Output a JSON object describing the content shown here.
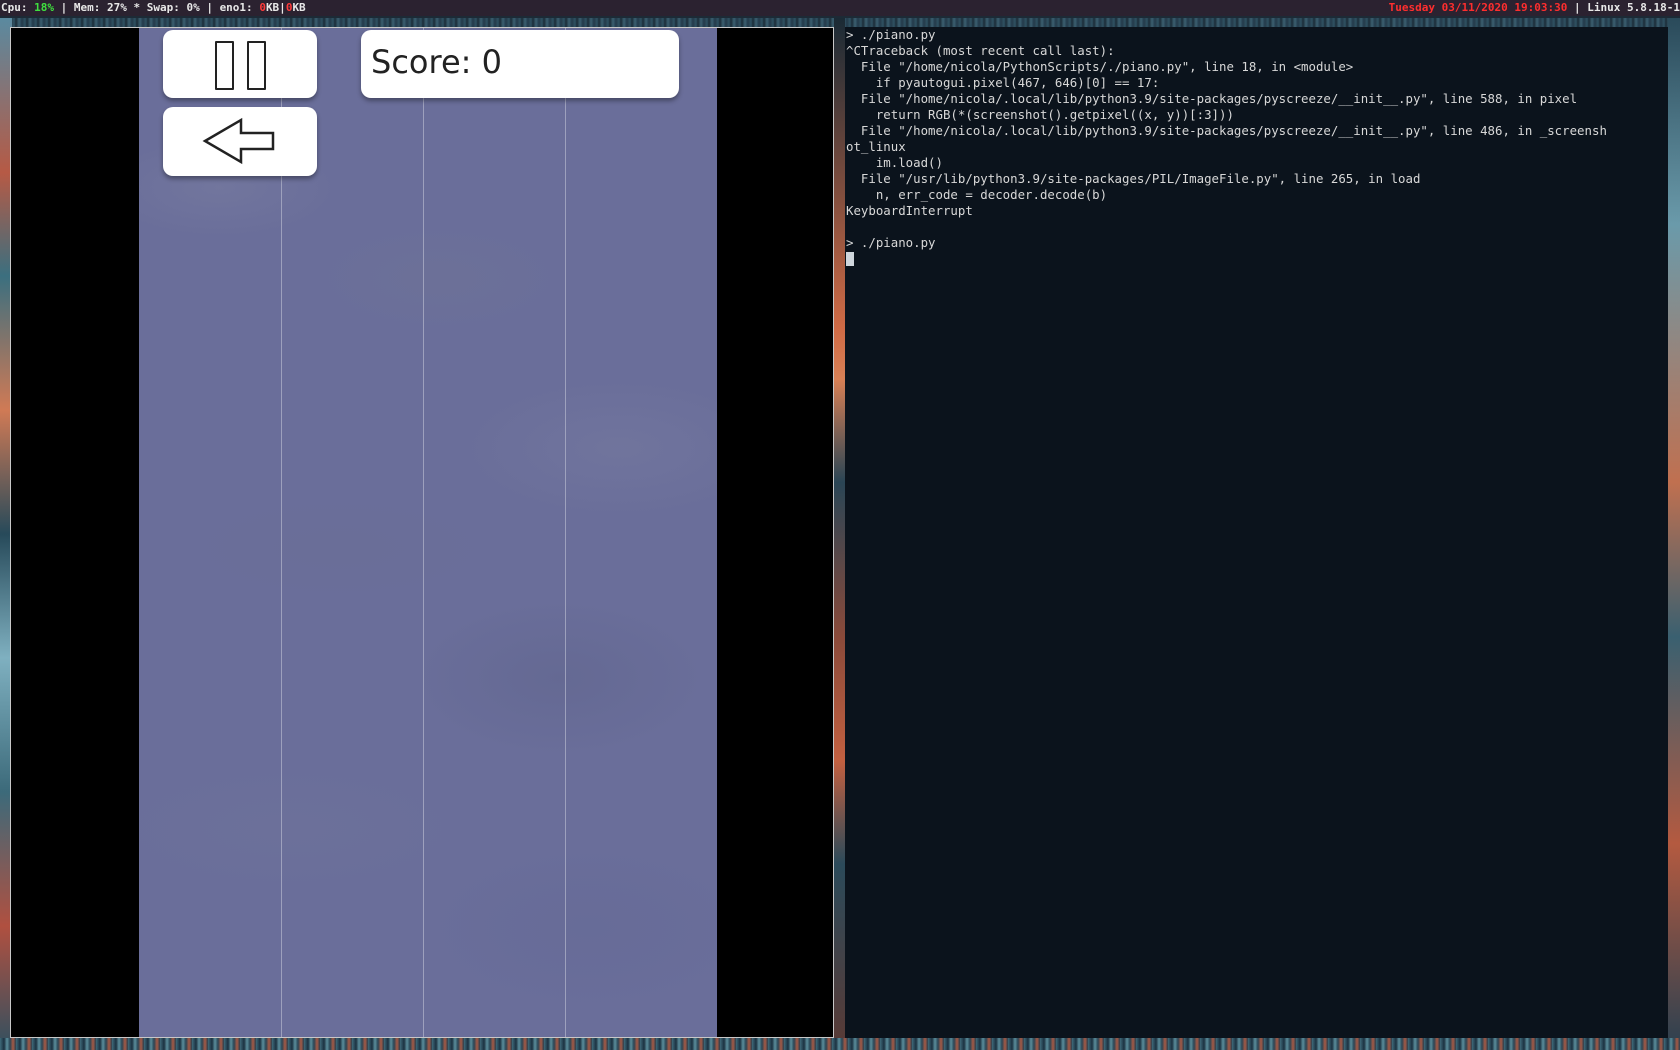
{
  "statusbar": {
    "cpu_label": "Cpu: ",
    "cpu_value": "18%",
    "mem": " | Mem: 27% * Swap: 0% | eno1: ",
    "net_down": "0",
    "net_sep": "KB|",
    "net_up": "0",
    "net_unit": "KB",
    "datetime": "Tuesday 03/11/2020 19:03:30",
    "kernel": " | Linux 5.8.18-1"
  },
  "game": {
    "score_label": "Score: 0",
    "pause_icon": "pause-icon",
    "back_icon": "back-arrow-icon"
  },
  "terminal": {
    "lines": [
      "> ./piano.py",
      "^CTraceback (most recent call last):",
      "  File \"/home/nicola/PythonScripts/./piano.py\", line 18, in <module>",
      "    if pyautogui.pixel(467, 646)[0] == 17:",
      "  File \"/home/nicola/.local/lib/python3.9/site-packages/pyscreeze/__init__.py\", line 588, in pixel",
      "    return RGB(*(screenshot().getpixel((x, y))[:3]))",
      "  File \"/home/nicola/.local/lib/python3.9/site-packages/pyscreeze/__init__.py\", line 486, in _screensh",
      "ot_linux",
      "    im.load()",
      "  File \"/usr/lib/python3.9/site-packages/PIL/ImageFile.py\", line 265, in load",
      "    n, err_code = decoder.decode(b)",
      "KeyboardInterrupt",
      "",
      "> ./piano.py"
    ]
  }
}
